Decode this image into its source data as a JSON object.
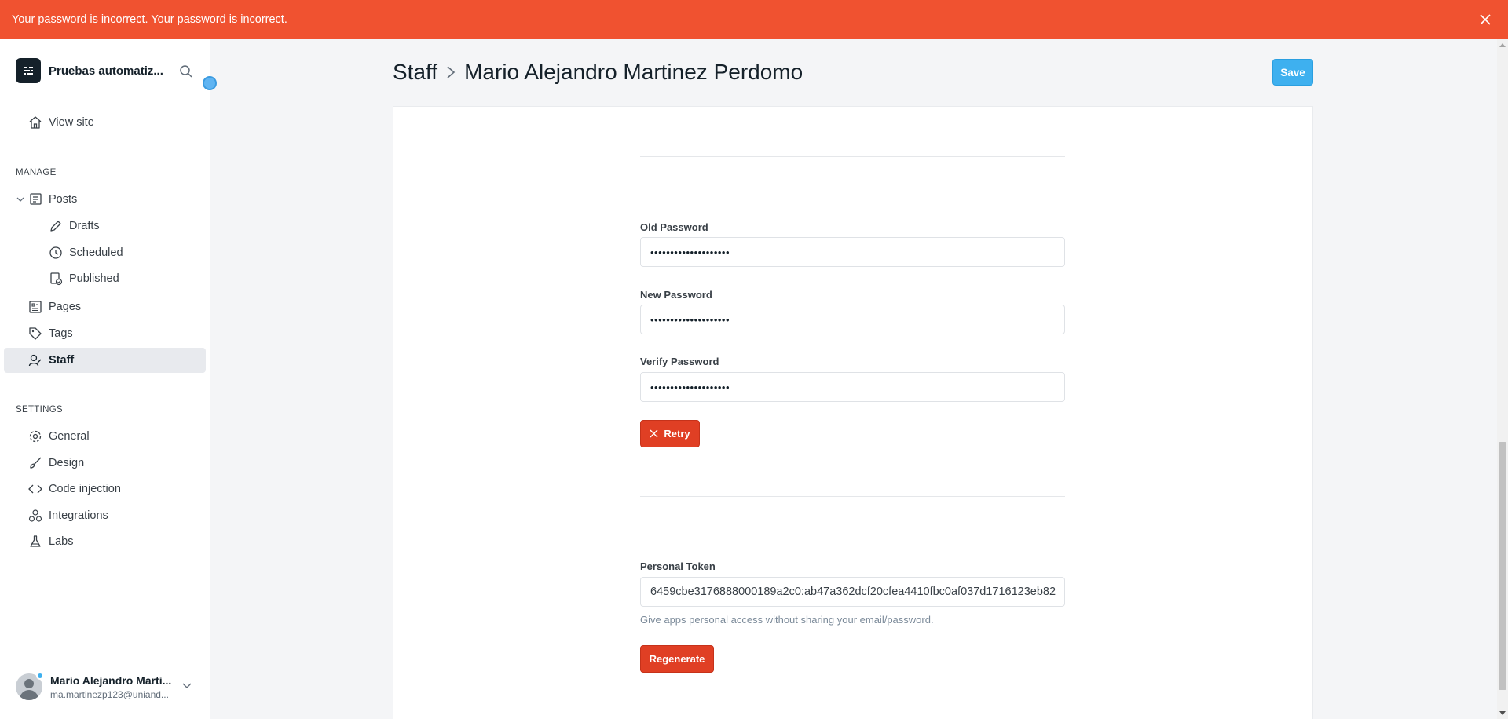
{
  "alert": {
    "message": "Your password is incorrect. Your password is incorrect."
  },
  "sidebar": {
    "site_name": "Pruebas automatiz...",
    "view_site": "View site",
    "manage_title": "MANAGE",
    "manage_items": {
      "posts": "Posts",
      "drafts": "Drafts",
      "scheduled": "Scheduled",
      "published": "Published",
      "pages": "Pages",
      "tags": "Tags",
      "staff": "Staff"
    },
    "settings_title": "SETTINGS",
    "settings_items": {
      "general": "General",
      "design": "Design",
      "code_injection": "Code injection",
      "integrations": "Integrations",
      "labs": "Labs"
    },
    "user": {
      "name": "Mario Alejandro Marti...",
      "email": "ma.martinezp123@uniand..."
    }
  },
  "header": {
    "breadcrumb_parent": "Staff",
    "breadcrumb_current": "Mario Alejandro Martinez Perdomo",
    "save_label": "Save"
  },
  "password_form": {
    "old_label": "Old Password",
    "old_value": "••••••••••••••••••••",
    "new_label": "New Password",
    "new_value": "••••••••••••••••••••",
    "verify_label": "Verify Password",
    "verify_value": "••••••••••••••••••••",
    "retry_label": "Retry"
  },
  "token": {
    "label": "Personal Token",
    "value": "6459cbe3176888000189a2c0:ab47a362dcf20cfea4410fbc0af037d1716123eb82",
    "help": "Give apps personal access without sharing your email/password.",
    "regenerate_label": "Regenerate"
  },
  "colors": {
    "alert_bg": "#f05230",
    "primary_blue": "#3eb0ef",
    "danger_red": "#e03f24",
    "active_nav_bg": "#e8eaee"
  }
}
